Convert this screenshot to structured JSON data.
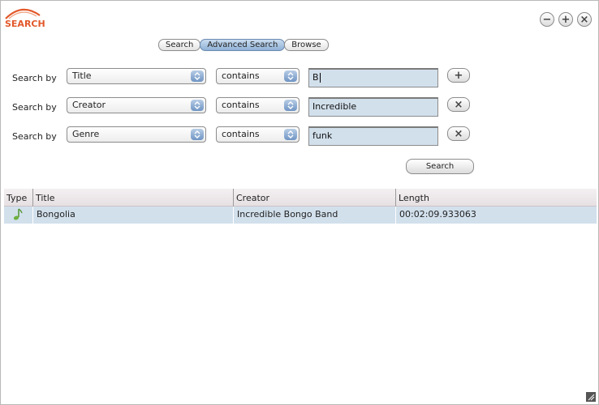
{
  "app": {
    "logo_text": "SEARCH"
  },
  "window_controls": {
    "minimize": "−",
    "maximize": "+",
    "close": "×"
  },
  "tabs": [
    {
      "label": "Search",
      "active": false
    },
    {
      "label": "Advanced Search",
      "active": true
    },
    {
      "label": "Browse",
      "active": false
    }
  ],
  "criteria": [
    {
      "label": "Search by",
      "field": "Title",
      "operator": "contains",
      "value": "B",
      "button": "+"
    },
    {
      "label": "Search by",
      "field": "Creator",
      "operator": "contains",
      "value": "Incredible",
      "button": "×"
    },
    {
      "label": "Search by",
      "field": "Genre",
      "operator": "contains",
      "value": "funk",
      "button": "×"
    }
  ],
  "search_button": "Search",
  "results": {
    "columns": [
      "Type",
      "Title",
      "Creator",
      "Length"
    ],
    "rows": [
      {
        "type_icon": "music-note-icon",
        "title": "Bongolia",
        "creator": "Incredible Bongo Band",
        "length": "00:02:09.933063"
      }
    ]
  },
  "colors": {
    "accent": "#e2582a",
    "selection": "#d2e0ec",
    "tab_active": "#8fb1d6"
  }
}
